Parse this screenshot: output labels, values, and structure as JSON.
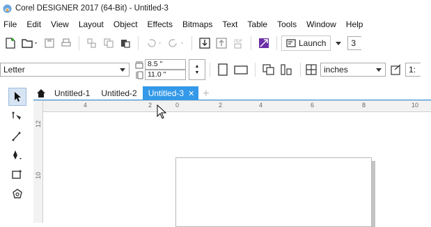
{
  "window": {
    "title": "Corel DESIGNER 2017 (64-Bit) - Untitled-3"
  },
  "menu": [
    "File",
    "Edit",
    "View",
    "Layout",
    "Object",
    "Effects",
    "Bitmaps",
    "Text",
    "Table",
    "Tools",
    "Window",
    "Help"
  ],
  "toolbar": {
    "launch_label": "Launch",
    "zoom_partial": "3"
  },
  "properties": {
    "page_size": "Letter",
    "width": "8.5 \"",
    "height": "11.0 \"",
    "units": "inches",
    "scale_partial": "1:"
  },
  "tabs": [
    {
      "label": "Untitled-1",
      "active": false
    },
    {
      "label": "Untitled-2",
      "active": false
    },
    {
      "label": "Untitled-3",
      "active": true
    }
  ],
  "ruler": {
    "h_labels": [
      "4",
      "2",
      "0",
      "2",
      "4",
      "6",
      "8",
      "10"
    ],
    "v_labels": [
      "12",
      "10"
    ]
  },
  "colors": {
    "accent": "#3399e8",
    "tab_active_text": "#ffffff"
  }
}
